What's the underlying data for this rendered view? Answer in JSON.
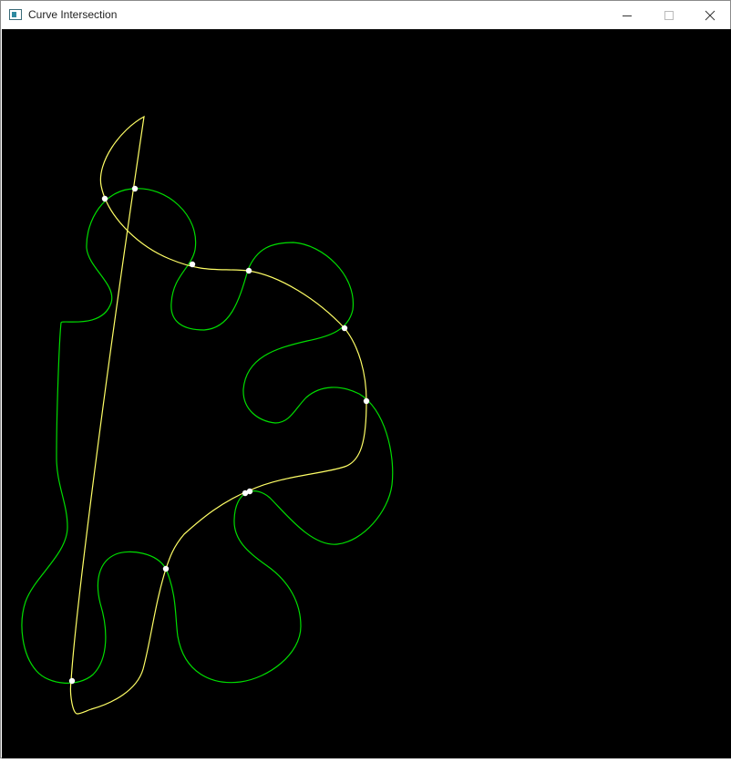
{
  "window": {
    "title": "Curve Intersection",
    "minimize_icon": "minimize-icon",
    "maximize_icon": "maximize-icon",
    "close_icon": "close-icon",
    "app_icon": "window-app-icon"
  },
  "canvas": {
    "background": "#000000",
    "curve_colors": {
      "yellow": "#ffff66",
      "green": "#00dd00",
      "points": "#ffffff"
    }
  }
}
